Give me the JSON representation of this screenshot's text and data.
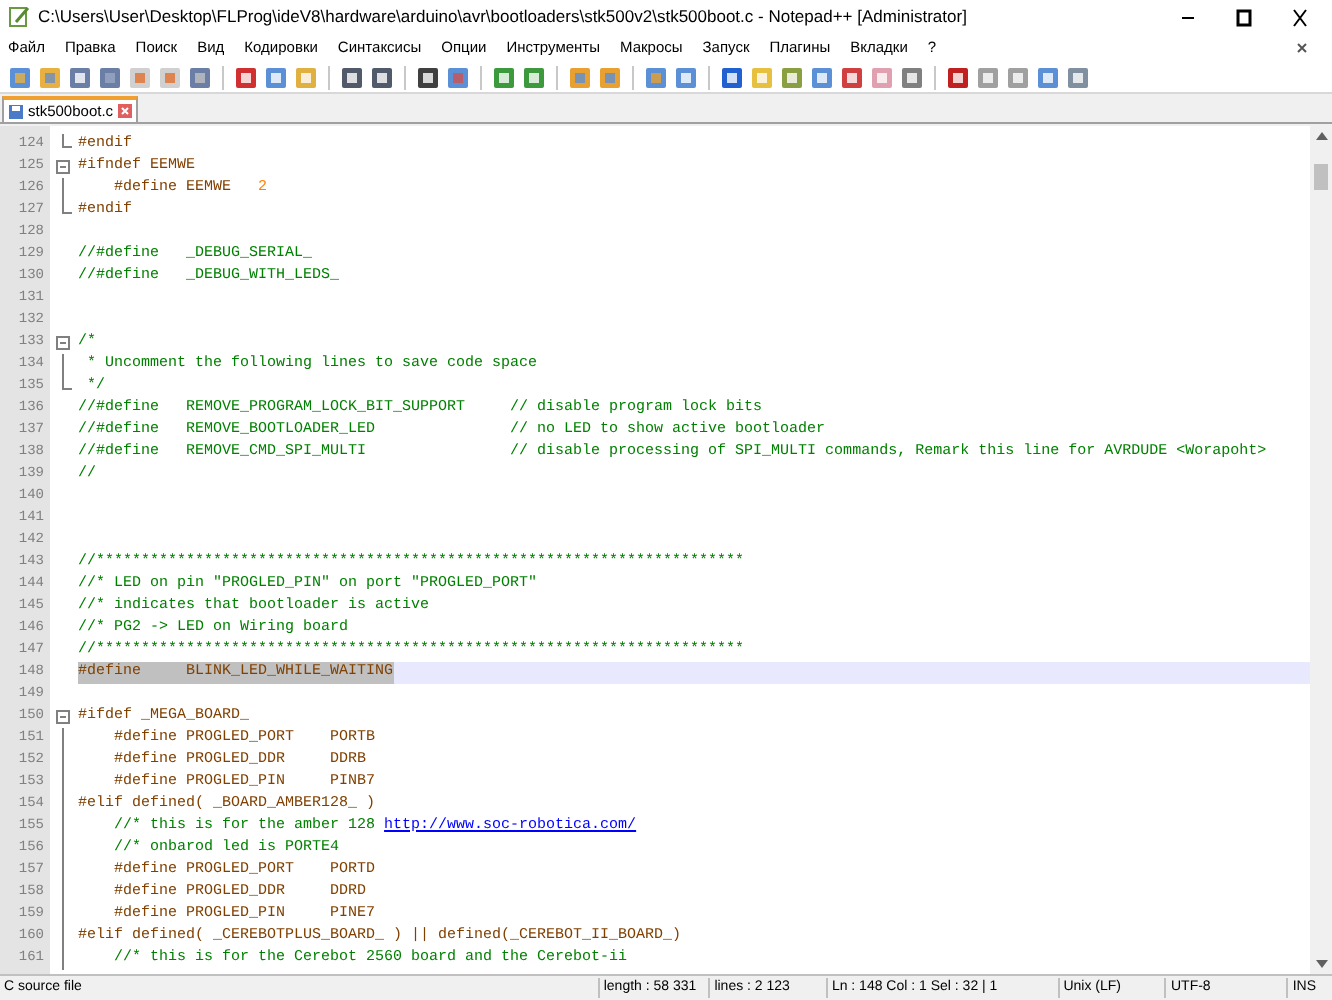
{
  "window": {
    "title": "C:\\Users\\User\\Desktop\\FLProg\\ideV8\\hardware\\arduino\\avr\\bootloaders\\stk500v2\\stk500boot.c - Notepad++ [Administrator]"
  },
  "menu": [
    "Файл",
    "Правка",
    "Поиск",
    "Вид",
    "Кодировки",
    "Синтаксисы",
    "Опции",
    "Инструменты",
    "Макросы",
    "Запуск",
    "Плагины",
    "Вкладки",
    "?"
  ],
  "tabs": [
    {
      "label": "stk500boot.c",
      "selected": true
    }
  ],
  "editor": {
    "lines": [
      {
        "number": "124",
        "kind": "end",
        "current": false,
        "tokens": [
          {
            "kind": "pre",
            "text": "#endif"
          }
        ]
      },
      {
        "number": "125",
        "kind": "open",
        "current": false,
        "tokens": [
          {
            "kind": "pre",
            "text": "#ifndef EEMWE"
          }
        ]
      },
      {
        "number": "126",
        "kind": "line",
        "current": false,
        "tokens": [
          {
            "kind": "pre",
            "text": "    #define EEMWE"
          },
          {
            "kind": "number",
            "text": "   2"
          }
        ]
      },
      {
        "number": "127",
        "kind": "end",
        "current": false,
        "tokens": [
          {
            "kind": "pre",
            "text": "#endif"
          }
        ]
      },
      {
        "number": "128",
        "kind": "plain",
        "current": false
      },
      {
        "number": "129",
        "kind": "plain",
        "current": false,
        "tokens": [
          {
            "kind": "comment",
            "text": "//#define   _DEBUG_SERIAL_"
          }
        ]
      },
      {
        "number": "130",
        "kind": "plain",
        "current": false,
        "tokens": [
          {
            "kind": "comment",
            "text": "//#define   _DEBUG_WITH_LEDS_"
          }
        ]
      },
      {
        "number": "131",
        "kind": "plain",
        "current": false
      },
      {
        "number": "132",
        "kind": "plain",
        "current": false
      },
      {
        "number": "133",
        "kind": "open",
        "current": false,
        "tokens": [
          {
            "kind": "comment",
            "text": "/*"
          }
        ]
      },
      {
        "number": "134",
        "kind": "line",
        "current": false,
        "tokens": [
          {
            "kind": "comment",
            "text": " * Uncomment the following lines to save code space"
          }
        ]
      },
      {
        "number": "135",
        "kind": "end",
        "current": false,
        "tokens": [
          {
            "kind": "comment",
            "text": " */"
          }
        ]
      },
      {
        "number": "136",
        "kind": "plain",
        "current": false,
        "tokens": [
          {
            "kind": "comment",
            "text": "//#define   REMOVE_PROGRAM_LOCK_BIT_SUPPORT     // disable program lock bits"
          }
        ]
      },
      {
        "number": "137",
        "kind": "plain",
        "current": false,
        "tokens": [
          {
            "kind": "comment",
            "text": "//#define   REMOVE_BOOTLOADER_LED               // no LED to show active bootloader"
          }
        ]
      },
      {
        "number": "138",
        "kind": "plain",
        "current": false,
        "tokens": [
          {
            "kind": "comment",
            "text": "//#define   REMOVE_CMD_SPI_MULTI                // disable processing of SPI_MULTI commands, Remark this line for AVRDUDE <Worapoht>"
          }
        ]
      },
      {
        "number": "139",
        "kind": "plain",
        "current": false,
        "tokens": [
          {
            "kind": "comment",
            "text": "//"
          }
        ]
      },
      {
        "number": "140",
        "kind": "plain",
        "current": false
      },
      {
        "number": "141",
        "kind": "plain",
        "current": false
      },
      {
        "number": "142",
        "kind": "plain",
        "current": false
      },
      {
        "number": "143",
        "kind": "plain",
        "current": false,
        "tokens": [
          {
            "kind": "comment",
            "text": "//************************************************************************"
          }
        ]
      },
      {
        "number": "144",
        "kind": "plain",
        "current": false,
        "tokens": [
          {
            "kind": "comment",
            "text": "//* LED on pin \"PROGLED_PIN\" on port \"PROGLED_PORT\""
          }
        ]
      },
      {
        "number": "145",
        "kind": "plain",
        "current": false,
        "tokens": [
          {
            "kind": "comment",
            "text": "//* indicates that bootloader is active"
          }
        ]
      },
      {
        "number": "146",
        "kind": "plain",
        "current": false,
        "tokens": [
          {
            "kind": "comment",
            "text": "//* PG2 -> LED on Wiring board"
          }
        ]
      },
      {
        "number": "147",
        "kind": "plain",
        "current": false,
        "tokens": [
          {
            "kind": "comment",
            "text": "//************************************************************************"
          }
        ]
      },
      {
        "number": "148",
        "kind": "plain",
        "current": true,
        "tokens": [
          {
            "kind": "selected",
            "text": "#define     BLINK_LED_WHILE_WAITING"
          }
        ]
      },
      {
        "number": "149",
        "kind": "plain",
        "current": false
      },
      {
        "number": "150",
        "kind": "open",
        "current": false,
        "tokens": [
          {
            "kind": "pre",
            "text": "#ifdef _MEGA_BOARD_"
          }
        ]
      },
      {
        "number": "151",
        "kind": "line",
        "current": false,
        "tokens": [
          {
            "kind": "pre",
            "text": "    #define PROGLED_PORT    PORTB"
          }
        ]
      },
      {
        "number": "152",
        "kind": "line",
        "current": false,
        "tokens": [
          {
            "kind": "pre",
            "text": "    #define PROGLED_DDR     DDRB"
          }
        ]
      },
      {
        "number": "153",
        "kind": "line",
        "current": false,
        "tokens": [
          {
            "kind": "pre",
            "text": "    #define PROGLED_PIN     PINB7"
          }
        ]
      },
      {
        "number": "154",
        "kind": "line",
        "current": false,
        "tokens": [
          {
            "kind": "pre",
            "text": "#elif defined( _BOARD_AMBER128_ )"
          }
        ]
      },
      {
        "number": "155",
        "kind": "line",
        "current": false,
        "tokens": [
          {
            "kind": "comment",
            "text": "    //* this is for the amber 128 "
          },
          {
            "kind": "link",
            "text": "http://www.soc-robotica.com/"
          }
        ]
      },
      {
        "number": "156",
        "kind": "line",
        "current": false,
        "tokens": [
          {
            "kind": "comment",
            "text": "    //* onbarod led is PORTE4"
          }
        ]
      },
      {
        "number": "157",
        "kind": "line",
        "current": false,
        "tokens": [
          {
            "kind": "pre",
            "text": "    #define PROGLED_PORT    PORTD"
          }
        ]
      },
      {
        "number": "158",
        "kind": "line",
        "current": false,
        "tokens": [
          {
            "kind": "pre",
            "text": "    #define PROGLED_DDR     DDRD"
          }
        ]
      },
      {
        "number": "159",
        "kind": "line",
        "current": false,
        "tokens": [
          {
            "kind": "pre",
            "text": "    #define PROGLED_PIN     PINE7"
          }
        ]
      },
      {
        "number": "160",
        "kind": "line",
        "current": false,
        "tokens": [
          {
            "kind": "pre",
            "text": "#elif defined( _CEREBOTPLUS_BOARD_ ) || defined(_CEREBOT_II_BOARD_)"
          }
        ]
      },
      {
        "number": "161",
        "kind": "line",
        "current": false,
        "tokens": [
          {
            "kind": "comment",
            "text": "    //* this is for the Cerebot 2560 board and the Cerebot-ii"
          }
        ]
      }
    ]
  },
  "status_bar": {
    "file_type": "C source file",
    "length": "length : 58 331",
    "lines": "lines : 2 123",
    "position": "Ln : 148   Col : 1   Sel : 32 | 1",
    "eol": "Unix (LF)",
    "encoding": "UTF-8",
    "mode": "INS"
  }
}
